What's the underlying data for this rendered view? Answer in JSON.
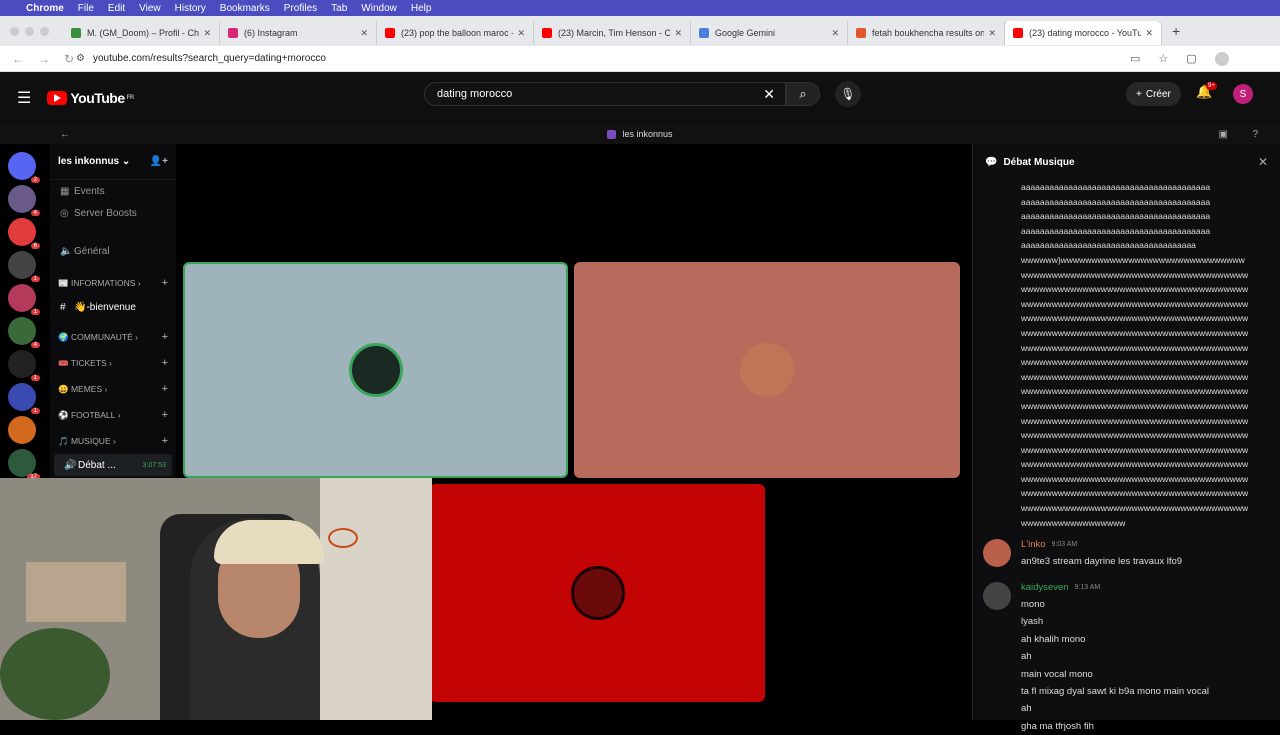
{
  "menubar": {
    "app": "Chrome",
    "items": [
      "File",
      "Edit",
      "View",
      "History",
      "Bookmarks",
      "Profiles",
      "Tab",
      "Window",
      "Help"
    ]
  },
  "tabs": [
    {
      "title": "M. (GM_Doom) – Profil - Che",
      "color": "#3a8f3a",
      "active": false
    },
    {
      "title": "(6) Instagram",
      "color": "#d62976",
      "active": false
    },
    {
      "title": "(23) pop the balloon maroc -",
      "color": "#ff0000",
      "active": false
    },
    {
      "title": "(23) Marcin, Tim Henson - Cl",
      "color": "#ff0000",
      "active": false
    },
    {
      "title": "Google Gemini",
      "color": "#4a7fe0",
      "active": false
    },
    {
      "title": "fetah boukhencha results on",
      "color": "#e2562b",
      "active": false
    },
    {
      "title": "(23) dating morocco - YouTub",
      "color": "#ff0000",
      "active": true
    }
  ],
  "address": {
    "url": "youtube.com/results?search_query=dating+morocco"
  },
  "youtube": {
    "logo_text": "YouTube",
    "region": "FR",
    "search_value": "dating morocco",
    "create_label": "Créer",
    "notif_badge": "9+",
    "avatar_letter": "S"
  },
  "discord": {
    "window_title": "les inkonnus",
    "server_name": "les inkonnus",
    "guild_badges": [
      "2",
      "4",
      "6",
      "1",
      "1",
      "4",
      "1",
      "1",
      "",
      "17"
    ],
    "channels_top": [
      {
        "icon": "▦",
        "label": "Events"
      },
      {
        "icon": "◎",
        "label": "Server Boosts"
      },
      {
        "icon": "🔊",
        "label": "Général"
      }
    ],
    "categories": [
      {
        "label": "📰 INFORMATIONS"
      },
      {
        "label": "🌍 COMMUNAUTÉ"
      },
      {
        "label": "🎟️ TICKETS"
      },
      {
        "label": "😄 MEMES"
      },
      {
        "label": "⚽ FOOTBALL"
      },
      {
        "label": "🎵 MUSIQUE"
      }
    ],
    "selected_channel": "👋-bienvenue",
    "voice_channel": {
      "label": "Débat ...",
      "time": "3:07:53"
    }
  },
  "thread": {
    "title": "Débat Musique",
    "spam_lines": [
      "aaaaaaaaaaaaaaaaaaaaaaaaaaaaaaaaaaaaaaaa",
      "aaaaaaaaaaaaaaaaaaaaaaaaaaaaaaaaaaaaaaaa",
      "aaaaaaaaaaaaaaaaaaaaaaaaaaaaaaaaaaaaaaaa",
      "aaaaaaaaaaaaaaaaaaaaaaaaaaaaaaaaaaaaaaaa",
      "aaaaaaaaaaaaaaaaaaaaaaaaaaaaaaaaaaaaa",
      "wwwwww}wwwwwwwwwwwwwwwwwwwwwwwwwwwwww",
      "wwwwwwwwwwwwwwwwwwwwwwwwwwwwwwwwwwwww",
      "wwwwwwwwwwwwwwwwwwwwwwwwwwwwwwwwwwwww",
      "wwwwwwwwwwwwwwwwwwwwwwwwwwwwwwwwwwwww",
      "wwwwwwwwwwwwwwwwwwwwwwwwwwwwwwwwwwwww",
      "wwwwwwwwwwwwwwwwwwwwwwwwwwwwwwwwwwwww",
      "wwwwwwwwwwwwwwwwwwwwwwwwwwwwwwwwwwwww",
      "wwwwwwwwwwwwwwwwwwwwwwwwwwwwwwwwwwwww",
      "wwwwwwwwwwwwwwwwwwwwwwwwwwwwwwwwwwwww",
      "wwwwwwwwwwwwwwwwwwwwwwwwwwwwwwwwwwwww",
      "wwwwwwwwwwwwwwwwwwwwwwwwwwwwwwwwwwwww",
      "wwwwwwwwwwwwwwwwwwwwwwwwwwwwwwwwwwwww",
      "wwwwwwwwwwwwwwwwwwwwwwwwwwwwwwwwwwwww",
      "wwwwwwwwwwwwwwwwwwwwwwwwwwwwwwwwwwwww",
      "wwwwwwwwwwwwwwwwwwwwwwwwwwwwwwwwwwwww",
      "wwwwwwwwwwwwwwwwwwwwwwwwwwwwwwwwwwwww",
      "wwwwwwwwwwwwwwwwwwwwwwwwwwwwwwwwwwwww",
      "wwwwwwwwwwwwwwwwwwwwwwwwwwwwwwwwwwwww",
      "wwwwwwwwwwwwwwwww"
    ],
    "messages": [
      {
        "author": "L'inko",
        "author_color": "#e07b4a",
        "time": "9:03 AM",
        "lines": [
          "an9te3 stream dayrine les travaux lfo9"
        ]
      },
      {
        "author": "kaidyseven",
        "author_color": "#3ba55d",
        "time": "9:13 AM",
        "lines": [
          "mono",
          "lyash",
          "ah khalih mono",
          "ah",
          "main vocal mono",
          "ta fl mixag dyal sawt ki b9a mono main vocal",
          "ah",
          "gha ma tfrjosh fih"
        ]
      }
    ]
  }
}
